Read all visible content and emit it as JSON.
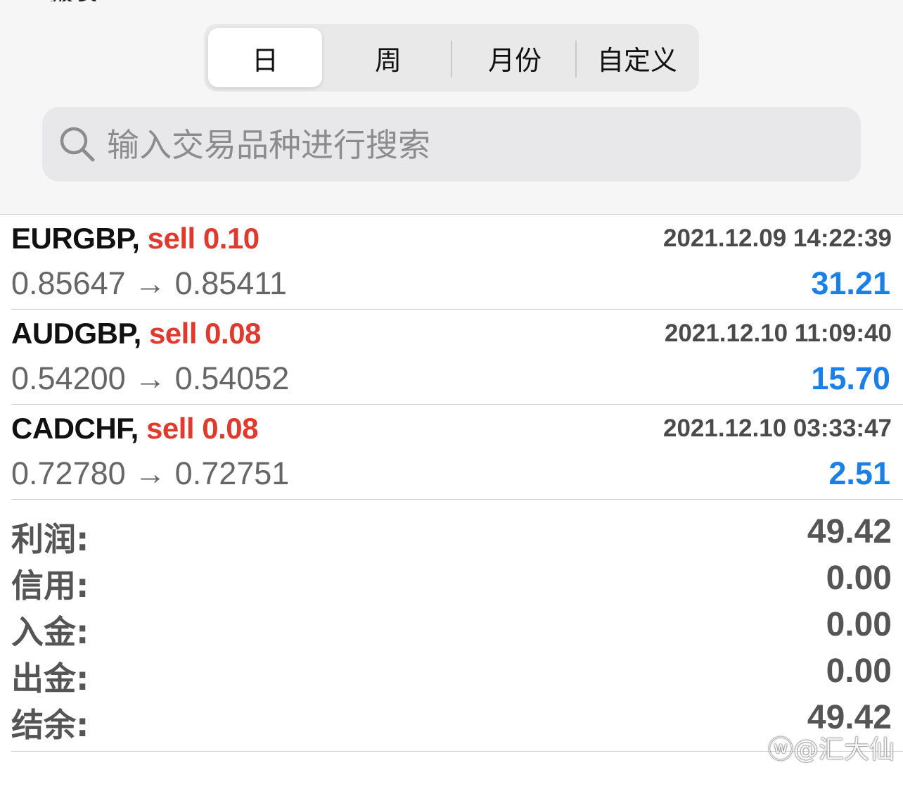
{
  "header": {
    "partial_title": "报表"
  },
  "period_tabs": [
    {
      "label": "日",
      "active": true
    },
    {
      "label": "周",
      "active": false
    },
    {
      "label": "月份",
      "active": false
    },
    {
      "label": "自定义",
      "active": false
    }
  ],
  "search": {
    "placeholder": "输入交易品种进行搜索",
    "value": ""
  },
  "trades": [
    {
      "symbol": "EURGBP,",
      "trade": "sell 0.10",
      "datetime": "2021.12.09 14:22:39",
      "prices": "0.85647 → 0.85411",
      "profit": "31.21"
    },
    {
      "symbol": "AUDGBP,",
      "trade": "sell 0.08",
      "datetime": "2021.12.10 11:09:40",
      "prices": "0.54200 → 0.54052",
      "profit": "15.70"
    },
    {
      "symbol": "CADCHF,",
      "trade": "sell 0.08",
      "datetime": "2021.12.10 03:33:47",
      "prices": "0.72780 → 0.72751",
      "profit": "2.51"
    }
  ],
  "summary": [
    {
      "label": "利润:",
      "value": "49.42"
    },
    {
      "label": "信用:",
      "value": "0.00"
    },
    {
      "label": "入金:",
      "value": "0.00"
    },
    {
      "label": "出金:",
      "value": "0.00"
    },
    {
      "label": "结余:",
      "value": "49.42"
    }
  ],
  "watermark": "@汇大仙",
  "colors": {
    "sell": "#e03a2f",
    "profit": "#1a7fe6",
    "header_bg": "#f6f6f6"
  }
}
